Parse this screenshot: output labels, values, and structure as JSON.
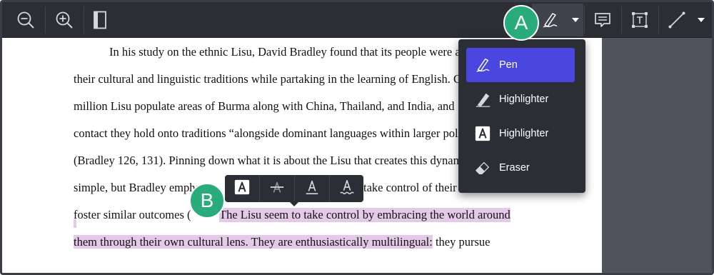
{
  "toolbar": {
    "buttons": [
      {
        "name": "zoom-out",
        "icon": "zoom-out-icon"
      },
      {
        "name": "zoom-in",
        "icon": "zoom-in-icon"
      },
      {
        "name": "single-page-view",
        "icon": "page-view-icon"
      },
      {
        "name": "pen-tool",
        "icon": "pen-icon",
        "active": true
      },
      {
        "name": "tool-dropdown",
        "icon": "caret-down-icon"
      },
      {
        "name": "comment",
        "icon": "comment-icon"
      },
      {
        "name": "text-box",
        "icon": "text-box-icon"
      },
      {
        "name": "line-tool",
        "icon": "line-icon"
      },
      {
        "name": "line-dropdown",
        "icon": "caret-down-icon"
      }
    ]
  },
  "document": {
    "lines": [
      "In his study on the ethnic Lisu, David Bradley found that its people were a",
      "their cultural and linguistic traditions while partaking in the learning of English. G",
      "million Lisu populate areas of Burma along with China, Thailand, and India, and",
      "contact they hold onto traditions “alongside dominant languages within larger pol",
      "(Bradley 126, 131). Pinning down what it is about the Lisu that creates this dynam",
      "simple, but Bradley empha",
      "take control of their",
      "foster similar outcomes (",
      "The Lisu seem to take control by embracing the world around",
      "them through their own cultural lens. They are enthusiastically multilingual:",
      " they pursue"
    ]
  },
  "tool_menu": {
    "items": [
      {
        "label": "Pen",
        "icon": "pen-icon",
        "selected": true
      },
      {
        "label": "Highlighter",
        "icon": "highlighter-icon",
        "selected": false
      },
      {
        "label": "Highlighter",
        "icon": "text-highlight-icon",
        "selected": false
      },
      {
        "label": "Eraser",
        "icon": "eraser-icon",
        "selected": false
      }
    ]
  },
  "markup_popup": {
    "buttons": [
      {
        "name": "highlight-text",
        "icon": "text-highlight-icon"
      },
      {
        "name": "strikethrough",
        "icon": "strikethrough-icon"
      },
      {
        "name": "underline",
        "icon": "underline-icon"
      },
      {
        "name": "squiggly",
        "icon": "squiggly-underline-icon"
      }
    ]
  },
  "callouts": {
    "a": "A",
    "b": "B"
  },
  "colors": {
    "toolbar_bg": "#2b2e34",
    "accent": "#4a46e0",
    "callout": "#2aab7b",
    "text_highlight": "#e4c9e8"
  }
}
